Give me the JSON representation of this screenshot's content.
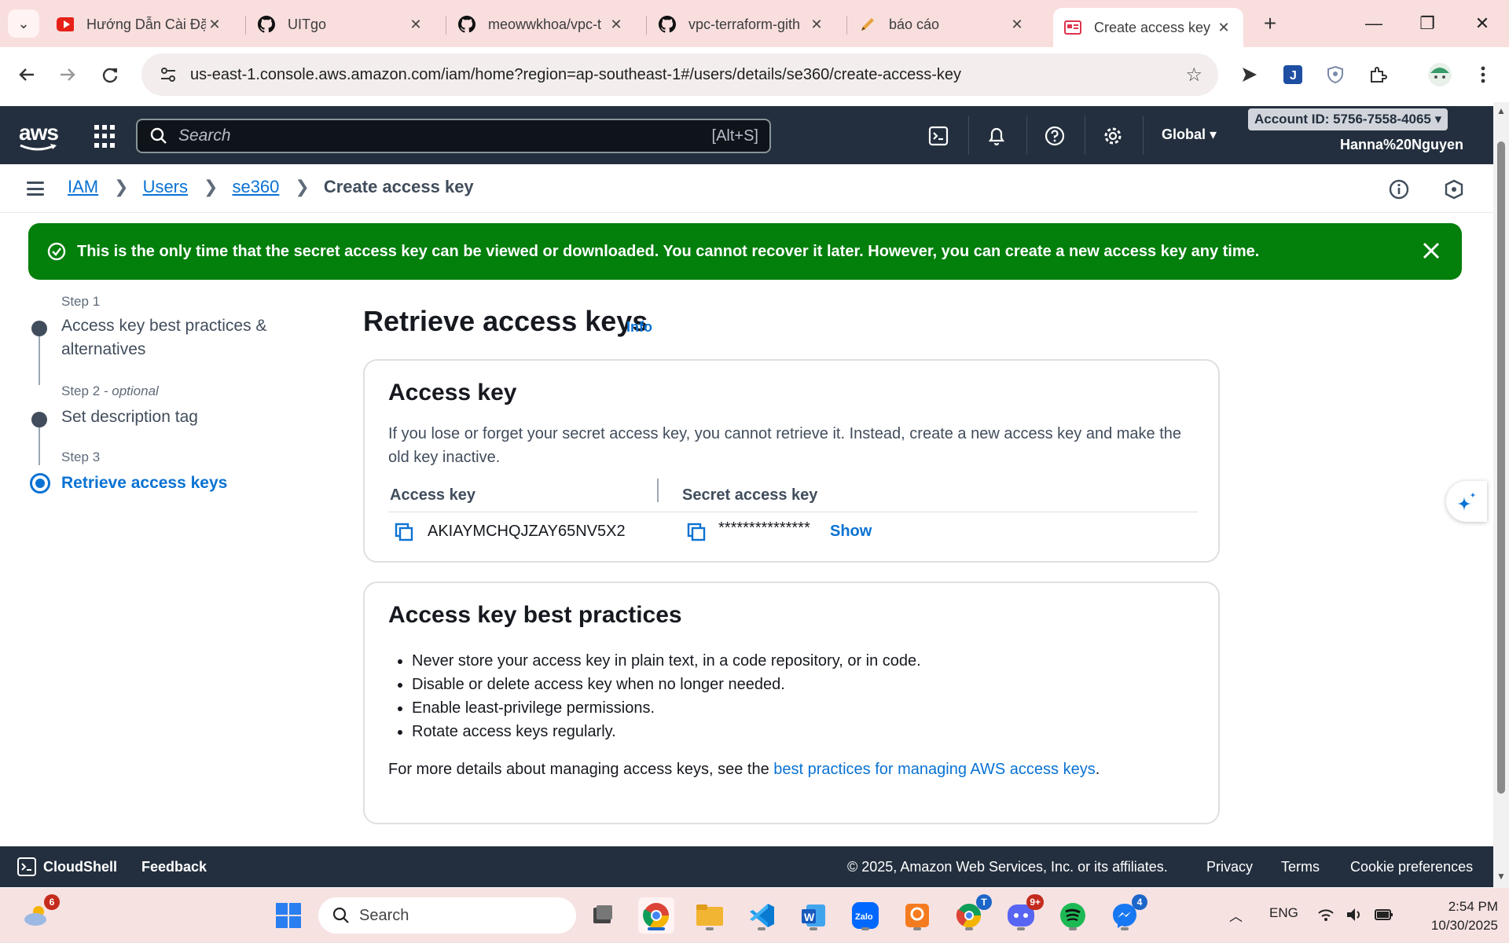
{
  "browser": {
    "tabs": [
      {
        "title": "Hướng Dẫn Cài Đặ",
        "icon": "youtube-icon"
      },
      {
        "title": "UITgo",
        "icon": "github-icon"
      },
      {
        "title": "meowwkhoa/vpc-t",
        "icon": "github-icon"
      },
      {
        "title": "vpc-terraform-gith",
        "icon": "github-icon"
      },
      {
        "title": "báo cáo",
        "icon": "pen-icon"
      },
      {
        "title": "Create access key |",
        "icon": "aws-iam-icon",
        "active": true
      }
    ],
    "url": "us-east-1.console.aws.amazon.com/iam/home?region=ap-southeast-1#/users/details/se360/create-access-key"
  },
  "aws_header": {
    "logo": "aws",
    "search_placeholder": "Search",
    "search_shortcut": "[Alt+S]",
    "region": "Global ▾",
    "account": "Account ID: 5756-7558-4065 ▾",
    "user": "Hanna%20Nguyen"
  },
  "breadcrumb": {
    "items": [
      "IAM",
      "Users",
      "se360"
    ],
    "current": "Create access key"
  },
  "flash": {
    "message": "This is the only time that the secret access key can be viewed or downloaded. You cannot recover it later. However, you can create a new access key any time.",
    "color": "#037f0c"
  },
  "steps": [
    {
      "label": "Step 1",
      "title": "Access key best practices & alternatives"
    },
    {
      "label": "Step 2",
      "label_suffix": "- optional",
      "title": "Set description tag"
    },
    {
      "label": "Step 3",
      "title": "Retrieve access keys",
      "active": true
    }
  ],
  "page": {
    "title": "Retrieve access keys",
    "info": "Info"
  },
  "access_key_card": {
    "title": "Access key",
    "description": "If you lose or forget your secret access key, you cannot retrieve it. Instead, create a new access key and make the old key inactive.",
    "col_access": "Access key",
    "col_secret": "Secret access key",
    "access_key_value": "AKIAYMCHQJZAY65NV5X2",
    "secret_masked": "***************",
    "show_label": "Show"
  },
  "best_practices_card": {
    "title": "Access key best practices",
    "items": [
      "Never store your access key in plain text, in a code repository, or in code.",
      "Disable or delete access key when no longer needed.",
      "Enable least-privilege permissions.",
      "Rotate access keys regularly."
    ],
    "more_prefix": "For more details about managing access keys, see the ",
    "more_link": "best practices for managing AWS access keys",
    "more_suffix": "."
  },
  "footer": {
    "cloudshell": "CloudShell",
    "feedback": "Feedback",
    "copyright": "© 2025, Amazon Web Services, Inc. or its affiliates.",
    "privacy": "Privacy",
    "terms": "Terms",
    "cookie": "Cookie preferences"
  },
  "taskbar": {
    "weather_badge": "6",
    "search_label": "Search",
    "zalo_label": "Zalo",
    "chrome2_badge": "T",
    "discord_badge": "9+",
    "messenger_badge": "4",
    "lang": "ENG",
    "time": "2:54 PM",
    "date": "10/30/2025"
  }
}
